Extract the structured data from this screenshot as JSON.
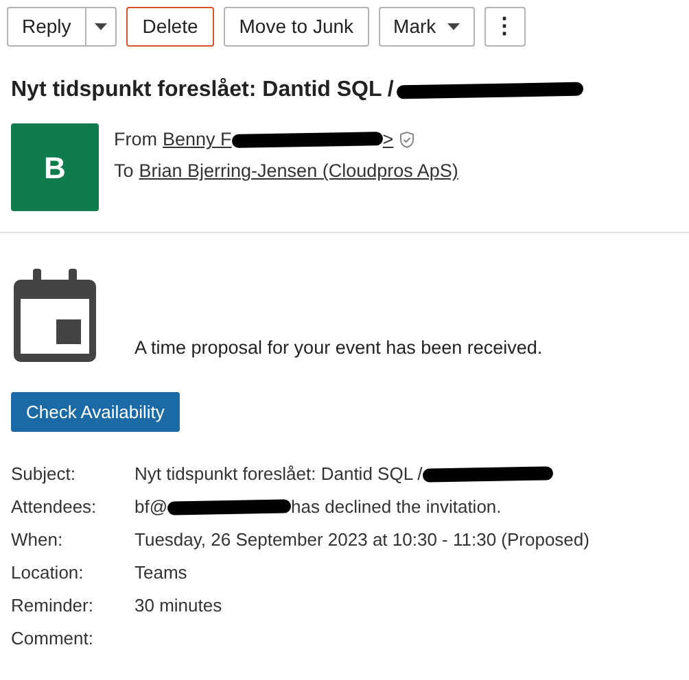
{
  "toolbar": [
    {
      "kind": "split",
      "label": "Reply"
    },
    {
      "kind": "danger",
      "label": "Delete"
    },
    {
      "kind": "plain",
      "label": "Move to Junk"
    },
    {
      "kind": "menu",
      "label": "Mark"
    },
    {
      "kind": "more",
      "label": "⋮"
    }
  ],
  "message": {
    "subject": "Nyt tidspunkt foreslået: Dantid SQL /",
    "avatar": "B",
    "from_label": "From",
    "from_name": "Benny F",
    "from_end": ">",
    "to_label": "To",
    "to_name": "Brian Bjerring-Jensen (Cloudpros ApS)"
  },
  "notice": "A time proposal for your event has been received.",
  "action": "Check Availability",
  "details": [
    {
      "label": "Subject:",
      "value": "Nyt tidspunkt foreslået: Dantid SQL /",
      "redacted_after": true
    },
    {
      "label": "Attendees:",
      "value": "bf@",
      "redacted_after": true,
      "rest": "has declined the invitation."
    },
    {
      "label": "When:",
      "value": "Tuesday, 26 September 2023 at 10:30 - 11:30 (Proposed)",
      "redacted_after": false
    },
    {
      "label": "Location:",
      "value": "Teams",
      "redacted_after": false
    },
    {
      "label": "Reminder:",
      "value": "30 minutes",
      "redacted_after": false
    },
    {
      "label": "Comment:"
    }
  ]
}
